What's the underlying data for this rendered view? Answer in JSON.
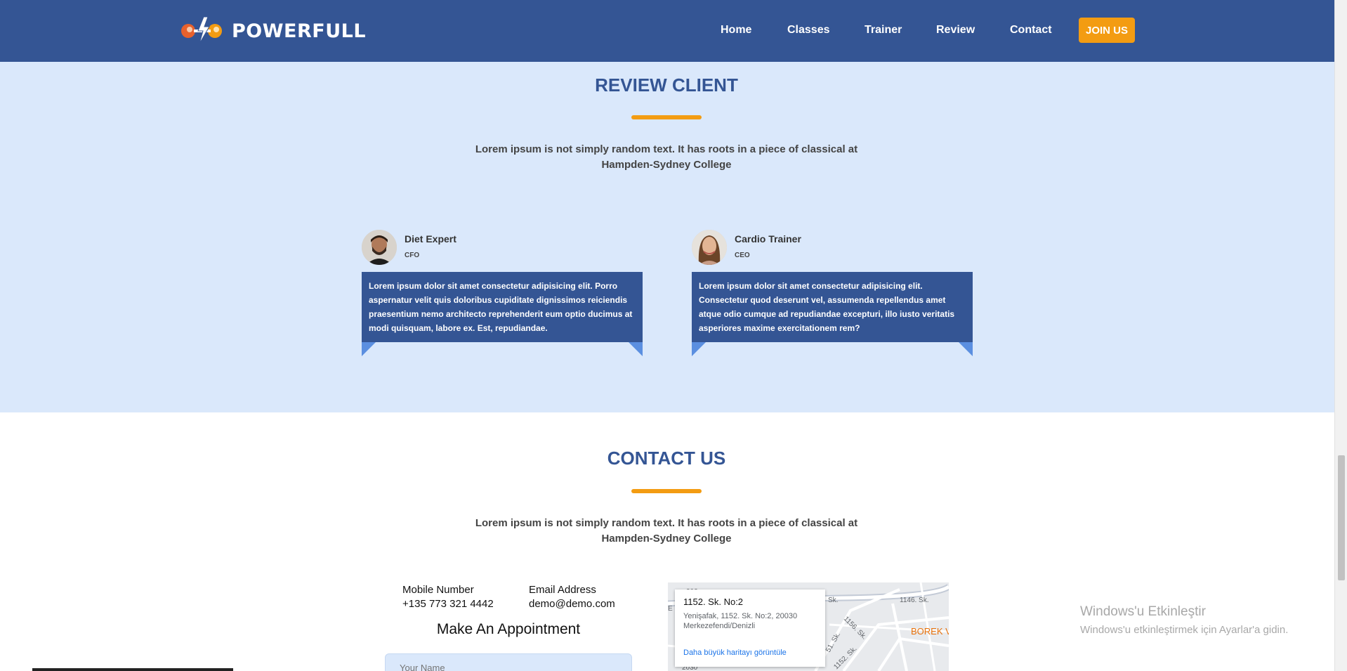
{
  "header": {
    "brand": "POWERFULL",
    "nav": [
      "Home",
      "Classes",
      "Trainer",
      "Review",
      "Contact"
    ],
    "join_label": "JOIN US",
    "colors": {
      "header_bg": "#345594",
      "accent": "#f39c12"
    }
  },
  "review": {
    "title": "REVIEW CLIENT",
    "subtitle": "Lorem ipsum is not simply random text. It has roots in a piece of classical at Hampden-Sydney College",
    "cards": [
      {
        "name": "Diet Expert",
        "role": "CFO",
        "text": "Lorem ipsum dolor sit amet consectetur adipisicing elit. Porro aspernatur velit quis doloribus cupiditate dignissimos reiciendis praesentium nemo architecto reprehenderit eum optio ducimus at modi quisquam, labore ex. Est, repudiandae."
      },
      {
        "name": "Cardio Trainer",
        "role": "CEO",
        "text": "Lorem ipsum dolor sit amet consectetur adipisicing elit. Consectetur quod deserunt vel, assumenda repellendus amet atque odio cumque ad repudiandae excepturi, illo iusto veritatis asperiores maxime exercitationem rem?"
      }
    ]
  },
  "contact": {
    "title": "CONTACT US",
    "subtitle": "Lorem ipsum is not simply random text. It has roots in a piece of classical at Hampden-Sydney College",
    "mobile_label": "Mobile Number",
    "mobile_value": "+135 773 321 4442",
    "email_label": "Email Address",
    "email_value": "demo@demo.com",
    "appointment_title": "Make An Appointment",
    "name_placeholder": "Your Name"
  },
  "map": {
    "place_title": "1152. Sk. No:2",
    "address_line1": "Yenişafak, 1152. Sk. No:2, 20030",
    "address_line2": "Merkezefendi/Denizli",
    "link": "Daha büyük haritayı görüntüle",
    "poi_label": "BOREK V",
    "street_labels": [
      "1146. Sk.",
      "1156. Sk.",
      "Sk.",
      "51. Sk.",
      "1152. Sk.",
      "2030",
      "203",
      "E"
    ]
  },
  "os_overlay": {
    "line1": "Windows'u Etkinleştir",
    "line2": "Windows'u etkinleştirmek için Ayarlar'a gidin."
  }
}
